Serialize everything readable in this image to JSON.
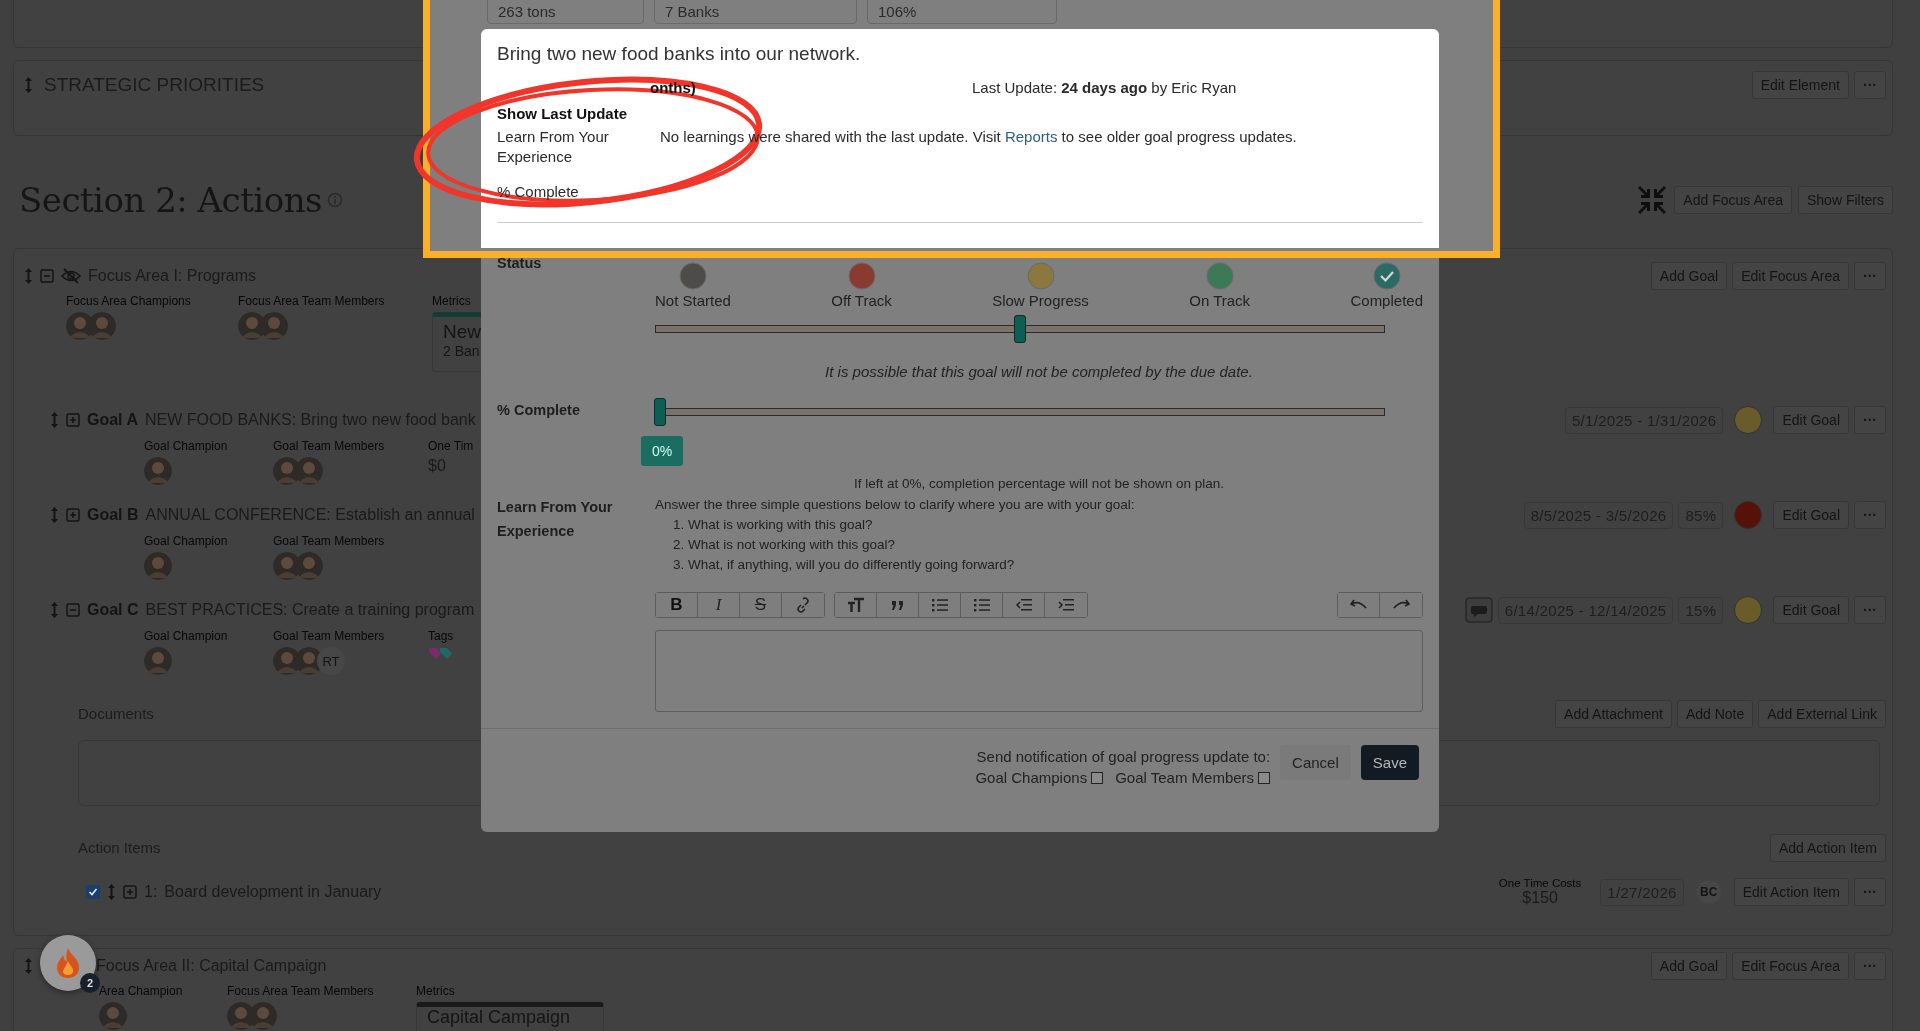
{
  "metric_cards": [
    "263 tons",
    "7 Banks",
    "106%"
  ],
  "strategic_priorities": {
    "title": "STRATEGIC PRIORITIES",
    "buttons": [
      "Edit Element"
    ],
    "more": "···"
  },
  "section": {
    "title": "Section 2: Actions",
    "buttons": [
      "Add Focus Area",
      "Show Filters"
    ]
  },
  "focus_area_1": {
    "title": "Focus Area I: Programs",
    "expanded": true,
    "hidden": true,
    "buttons": [
      "Add Goal",
      "Edit Focus Area"
    ],
    "more": "···",
    "people": [
      {
        "label": "Focus Area Champions",
        "avatars": [
          {
            "kind": "photo"
          },
          {
            "kind": "photo"
          }
        ]
      },
      {
        "label": "Focus Area Team Members",
        "avatars": [
          {
            "kind": "photo"
          },
          {
            "kind": "photo"
          }
        ]
      }
    ],
    "metric": {
      "label": "Metrics",
      "title": "New",
      "value": "2 Ban"
    },
    "goals": [
      {
        "code": "Goal A",
        "title": "NEW FOOD BANKS: Bring two new food bank",
        "expanded": false,
        "comment": false,
        "dates": "5/1/2025 - 1/31/2026",
        "color": "#695b2a",
        "button": "Edit Goal",
        "more": "···",
        "fields": [
          {
            "kind": "people",
            "label": "Goal Champion",
            "avatars": [
              {
                "kind": "photo"
              }
            ]
          },
          {
            "kind": "people",
            "label": "Goal Team Members",
            "avatars": [
              {
                "kind": "photo"
              },
              {
                "kind": "photo"
              }
            ]
          },
          {
            "kind": "cost",
            "label": "One Tim",
            "value": "$0"
          }
        ]
      },
      {
        "code": "Goal B",
        "title": "ANNUAL CONFERENCE: Establish an annual",
        "expanded": false,
        "comment": false,
        "dates": "8/5/2025 - 3/5/2026",
        "percent": "85%",
        "color": "#561209",
        "button": "Edit Goal",
        "more": "···",
        "fields": [
          {
            "kind": "people",
            "label": "Goal Champion",
            "avatars": [
              {
                "kind": "photo"
              }
            ]
          },
          {
            "kind": "people",
            "label": "Goal Team Members",
            "avatars": [
              {
                "kind": "photo"
              },
              {
                "kind": "photo"
              }
            ]
          }
        ]
      },
      {
        "code": "Goal C",
        "title": "BEST PRACTICES: Create a training program",
        "expanded": true,
        "comment": true,
        "dates": "6/14/2025 - 12/14/2025",
        "percent": "15%",
        "color": "#695b2a",
        "button": "Edit Goal",
        "more": "···",
        "fields": [
          {
            "kind": "people",
            "label": "Goal Champion",
            "avatars": [
              {
                "kind": "photo"
              }
            ]
          },
          {
            "kind": "people",
            "label": "Goal Team Members",
            "avatars": [
              {
                "kind": "photo"
              },
              {
                "kind": "photo"
              },
              {
                "kind": "initials",
                "text": "RT"
              }
            ]
          },
          {
            "kind": "tags",
            "label": "Tags",
            "tags": [
              {
                "color": "#7a2a6e"
              },
              {
                "color": "#1d6a62"
              }
            ]
          }
        ],
        "documents": {
          "title": "Documents",
          "buttons": [
            "Add Attachment",
            "Add Note",
            "Add External Link"
          ]
        },
        "action_items": {
          "title": "Action Items",
          "button": "Add Action Item",
          "items": [
            {
              "checked": true,
              "number": "1:",
              "title": "Board development in January",
              "cost_label": "One Time Costs",
              "cost": "$150",
              "date": "1/27/2026",
              "assignee": "BC",
              "button": "Edit Action Item",
              "more": "···"
            }
          ]
        }
      }
    ]
  },
  "focus_area_2": {
    "title": "Focus Area II: Capital Campaign",
    "buttons": [
      "Add Goal",
      "Edit Focus Area"
    ],
    "more": "···",
    "people": [
      {
        "label": "Area Champion",
        "avatars": [
          {
            "kind": "photo"
          }
        ]
      },
      {
        "label": "Focus Area Team Members",
        "avatars": [
          {
            "kind": "photo"
          },
          {
            "kind": "photo"
          }
        ]
      }
    ],
    "metric": {
      "label": "Metrics",
      "title": "Capital Campaign"
    }
  },
  "help_button": {
    "badge": "2"
  },
  "popover": {
    "title": "Bring two new food banks into our network.",
    "due_fragment": "onths)",
    "last_update": "Last Update:  **24 days ago**  by Eric Ryan",
    "show_last_update": "Show Last Update",
    "learn_label": "Learn From Your Experience",
    "learn_before": "No learnings were shared with the last update. Visit",
    "learn_link": "Reports",
    "learn_after": "to see older goal progress updates.",
    "percent_label": "% Complete"
  },
  "modal": {
    "status": {
      "label": "Status",
      "options": [
        {
          "label": "Not Started",
          "color": "#4e4c49",
          "kind": "dot"
        },
        {
          "label": "Off Track",
          "color": "#8a3a2f",
          "kind": "dot"
        },
        {
          "label": "Slow Progress",
          "color": "#8c773e",
          "kind": "dot"
        },
        {
          "label": "On Track",
          "color": "#3c7955",
          "kind": "dot"
        },
        {
          "label": "Completed",
          "color": "#2b6b66",
          "kind": "check"
        }
      ],
      "level": 0.5,
      "note": "It is possible that this goal will not be completed by the due date."
    },
    "percent": {
      "label": "% Complete",
      "level": 0,
      "badge": "0%",
      "note": "If left at 0%, completion percentage will not be shown on plan."
    },
    "learn": {
      "label": "Learn From Your Experience",
      "intro": "Answer the three simple questions below to clarify where you are with your goal:",
      "questions": [
        {
          "number": "1.",
          "text": "What is working with this goal?"
        },
        {
          "number": "2.",
          "text": "What is not working with this goal?"
        },
        {
          "number": "3.",
          "text": "What, if anything, will you do differently going forward?"
        }
      ]
    },
    "toolbar": {
      "groups": [
        [
          {
            "kind": "bold",
            "label": "B"
          },
          {
            "kind": "italic",
            "label": "I"
          },
          {
            "kind": "strike",
            "label": "S"
          },
          {
            "kind": "link"
          }
        ],
        [
          {
            "kind": "heading"
          },
          {
            "kind": "quote"
          },
          {
            "kind": "bullets"
          },
          {
            "kind": "numbers"
          },
          {
            "kind": "outdent"
          },
          {
            "kind": "indent"
          }
        ]
      ],
      "history": [
        {
          "kind": "undo"
        },
        {
          "kind": "redo"
        }
      ]
    },
    "footer": {
      "notify": "Send notification of goal progress update to:",
      "checkboxes": [
        {
          "label": "Goal Champions",
          "checked": false
        },
        {
          "label": "Goal Team Members",
          "checked": false
        }
      ],
      "buttons": [
        {
          "label": "Cancel",
          "kind": "secondary"
        },
        {
          "label": "Save",
          "kind": "primary"
        }
      ]
    }
  }
}
